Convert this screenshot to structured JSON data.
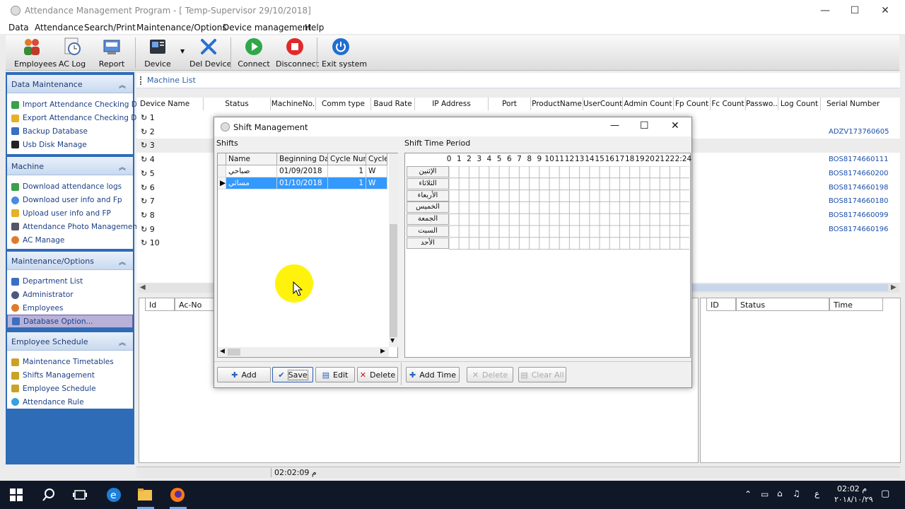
{
  "window": {
    "title": "Attendance Management Program - [ Temp-Supervisor 29/10/2018]",
    "minimize": "—",
    "maximize": "☐",
    "close": "✕"
  },
  "menu": [
    "Data",
    "Attendance",
    "Search/Print",
    "Maintenance/Options",
    "Device management",
    "Help"
  ],
  "toolbar": {
    "employees": "Employees",
    "ac_log": "AC Log",
    "report": "Report",
    "device": "Device",
    "del_device": "Del Device",
    "connect": "Connect",
    "disconnect": "Disconnect",
    "exit": "Exit system"
  },
  "sidebar": {
    "data_maintenance": {
      "title": "Data Maintenance",
      "items": [
        "Import Attendance Checking Data",
        "Export Attendance Checking Data",
        "Backup Database",
        "Usb Disk Manage"
      ]
    },
    "machine": {
      "title": "Machine",
      "items": [
        "Download attendance logs",
        "Download user info and Fp",
        "Upload user info and FP",
        "Attendance Photo Management",
        "AC Manage"
      ]
    },
    "maintenance": {
      "title": "Maintenance/Options",
      "items": [
        "Department List",
        "Administrator",
        "Employees",
        "Database Option..."
      ]
    },
    "schedule": {
      "title": "Employee Schedule",
      "items": [
        "Maintenance Timetables",
        "Shifts Management",
        "Employee Schedule",
        "Attendance Rule"
      ]
    }
  },
  "machine_list": {
    "title": "Machine List",
    "columns": [
      "Device Name",
      "Status",
      "MachineNo.",
      "Comm type",
      "Baud Rate",
      "IP Address",
      "Port",
      "ProductName",
      "UserCount",
      "Admin Count",
      "Fp Count",
      "Fc Count",
      "Passwo...",
      "Log Count",
      "Serial Number"
    ],
    "rows": [
      {
        "no": "1",
        "serial": ""
      },
      {
        "no": "2",
        "serial": "ADZV173760605"
      },
      {
        "no": "3",
        "serial": ""
      },
      {
        "no": "4",
        "serial": "BOS8174660111"
      },
      {
        "no": "5",
        "serial": "BOS8174660200"
      },
      {
        "no": "6",
        "serial": "BOS8174660198"
      },
      {
        "no": "7",
        "serial": "BOS8174660180"
      },
      {
        "no": "8",
        "serial": "BOS8174660099"
      },
      {
        "no": "9",
        "serial": "BOS8174660196"
      },
      {
        "no": "10",
        "serial": ""
      }
    ]
  },
  "log_panel": {
    "col_id": "Id",
    "col_acno": "Ac-No"
  },
  "right_panel": {
    "col_id": "ID",
    "col_status": "Status",
    "col_time": "Time"
  },
  "statusbar": {
    "time": "02:02:09 م"
  },
  "dialog": {
    "title": "Shift Management",
    "shifts_label": "Shifts",
    "period_label": "Shift Time Period",
    "columns": [
      "Name",
      "Beginning Date",
      "Cycle Num",
      "Cycle"
    ],
    "rows": [
      {
        "name": "صباحي",
        "date": "01/09/2018",
        "num": "1",
        "cycle": "W"
      },
      {
        "name": "مسائي",
        "date": "01/10/2018",
        "num": "1",
        "cycle": "W"
      }
    ],
    "hours": [
      "0",
      "1",
      "2",
      "3",
      "4",
      "5",
      "6",
      "7",
      "8",
      "9",
      "10",
      "11",
      "12",
      "13",
      "14",
      "15",
      "16",
      "17",
      "18",
      "19",
      "20",
      "21",
      "22",
      "2:24"
    ],
    "days": [
      "الإثنين",
      "الثلاثاء",
      "الأربعاء",
      "الخميس",
      "الجمعة",
      "السبت",
      "الأحد"
    ],
    "buttons": {
      "add": "Add",
      "save": "Save",
      "edit": "Edit",
      "delete": "Delete",
      "add_time": "Add Time",
      "delete_time": "Delete",
      "clear_all": "Clear All"
    }
  },
  "taskbar": {
    "time": "02:02 م",
    "date": "٢٠١٨/١٠/٢٩",
    "lang": "ع"
  }
}
